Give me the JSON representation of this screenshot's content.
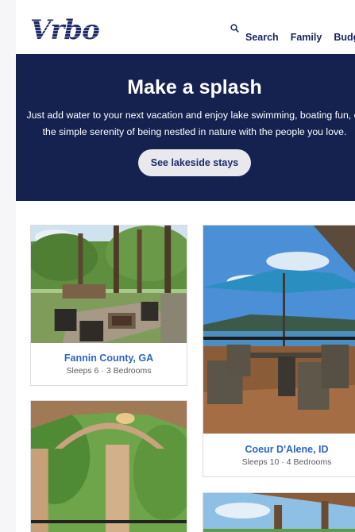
{
  "brand": {
    "logo_text": "Vrbo",
    "color": "#1f2a6b"
  },
  "header": {
    "search_icon": "search-icon",
    "nav": [
      {
        "label": "Search"
      },
      {
        "label": "Family"
      },
      {
        "label": "Budget"
      }
    ]
  },
  "hero": {
    "title": "Make a splash",
    "line1": "Just add water to your next vacation and enjoy lake swimming, boating fun, or",
    "line2": "the simple serenity of being nestled in nature with the people you love.",
    "cta": "See lakeside stays",
    "background": "#152250"
  },
  "cards": [
    {
      "title": "Fannin County, GA",
      "sleeps": "Sleeps 6",
      "bedrooms": "3 Bedrooms"
    },
    {
      "title": "Coeur D'Alene, ID",
      "sleeps": "Sleeps 10",
      "bedrooms": "4 Bedrooms"
    }
  ],
  "separator": "·"
}
